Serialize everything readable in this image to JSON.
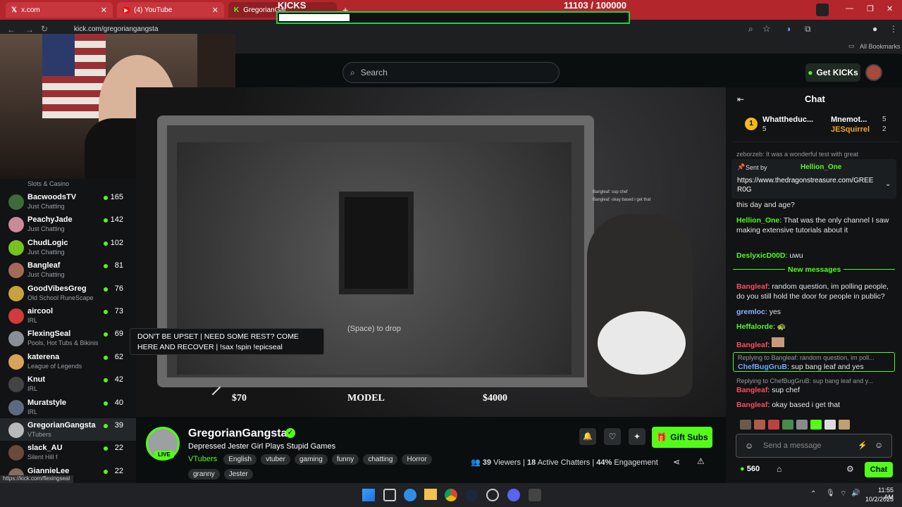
{
  "browser": {
    "tabs": [
      {
        "label": "x.com"
      },
      {
        "label": "(4) YouTube"
      },
      {
        "label": "GregorianGangsta"
      }
    ],
    "url": "kick.com/gregoriangangsta",
    "bookmarks_label": "All Bookmarks",
    "status_url": "https://kick.com/flexingseal"
  },
  "overlay": {
    "kicks_label": "KICKS",
    "kicks_count": "11103  / 100000",
    "kicks_progress": 0.111
  },
  "header": {
    "search_placeholder": "Search",
    "get_kicks_label": "Get KICKs"
  },
  "sidebar": {
    "top_category": "Slots & Casino",
    "channels": [
      {
        "name": "BacwoodsTV",
        "category": "Just Chatting",
        "viewers": "165",
        "color": "#3e6b3a"
      },
      {
        "name": "PeachyJade",
        "category": "Just Chatting",
        "viewers": "142",
        "color": "#c98a9c"
      },
      {
        "name": "ChudLogic",
        "category": "Just Chatting",
        "viewers": "102",
        "color": "#76c21f"
      },
      {
        "name": "Bangleaf",
        "category": "Just Chatting",
        "viewers": "81",
        "color": "#a46a58"
      },
      {
        "name": "GoodVibesGreg",
        "category": "Old School RuneScape",
        "viewers": "76",
        "color": "#c8a23c"
      },
      {
        "name": "aircool",
        "category": "IRL",
        "viewers": "73",
        "color": "#d23b3b"
      },
      {
        "name": "FlexingSeal",
        "category": "Pools, Hot Tubs & Bikinis",
        "viewers": "69",
        "color": "#8a8f96"
      },
      {
        "name": "katerena",
        "category": "League of Legends",
        "viewers": "62",
        "color": "#d9a35a"
      },
      {
        "name": "Knut",
        "category": "IRL",
        "viewers": "42",
        "color": "#444"
      },
      {
        "name": "Muratstyle",
        "category": "IRL",
        "viewers": "40",
        "color": "#5b6a80"
      },
      {
        "name": "GregorianGangsta",
        "category": "VTubers",
        "viewers": "39",
        "color": "#b9b9b9"
      },
      {
        "name": "slack_AU",
        "category": "Silent Hill f",
        "viewers": "22",
        "color": "#6b4a3a"
      },
      {
        "name": "GiannieLee",
        "category": "",
        "viewers": "22",
        "color": "#8a6a5a"
      }
    ]
  },
  "game": {
    "tooltip": "DON'T BE UPSET | NEED SOME REST? COME HERE AND RECOVER | !sax !spin !epicseal",
    "drop_hint": "(Space) to drop",
    "price_left": "$70",
    "model_label": "MODEL",
    "price_right": "$4000",
    "mini_chat": [
      {
        "user": "Bangleaf",
        "text": "sup chef"
      },
      {
        "user": "Bangleaf",
        "text": "okay based i get that"
      }
    ]
  },
  "stream": {
    "channel_name": "GregorianGangsta",
    "live_label": "LIVE",
    "title": "Depressed Jester Girl Plays Stupid Games",
    "category": "VTubers",
    "tags": [
      "English",
      "vtuber",
      "gaming",
      "funny",
      "chatting",
      "Horror",
      "granny",
      "Jester"
    ],
    "viewers": "39",
    "viewers_label": "Viewers",
    "chatters": "18",
    "chatters_label": "Active Chatters",
    "engagement": "44%",
    "engagement_label": "Engagement",
    "gift_subs_label": "Gift Subs"
  },
  "chat": {
    "title": "Chat",
    "leaderboard": [
      {
        "rank": "1",
        "name": "Whattheduc...",
        "count": "5"
      },
      {
        "name": "Mnemot...",
        "count": "5"
      },
      {
        "name": "JESquirrel",
        "count": "2"
      }
    ],
    "pinned_cut": "zeborzeb: It was a wonderful test with great",
    "pinned_sent_by": "Sent by",
    "pinned_user": "Hellion_One",
    "pinned_link": "https://www.thedragonstreasure.com/GREER0G",
    "messages_top": [
      {
        "user": "",
        "text": "this day and age?"
      },
      {
        "user": "Hellion_One",
        "text": "That was the only channel I saw making extensive tutorials about it"
      },
      {
        "user": "DeslyxicD00D",
        "text": "uwu"
      }
    ],
    "new_messages_label": "New messages",
    "messages": [
      {
        "user": "Bangleaf",
        "text": "random question, im polling people, do you still hold the door for people in public?"
      },
      {
        "user": "gremloc",
        "text": "yes"
      },
      {
        "user": "Heffalorde",
        "text": ""
      },
      {
        "user": "Bangleaf",
        "text": ""
      },
      {
        "reply": "Replying to Bangleaf: random question, im poll...",
        "user": "ChefBugGruB",
        "text": "sup bang leaf and yes"
      },
      {
        "reply": "Replying to ChefBugGruB: sup bang leaf and y...",
        "user": "Bangleaf",
        "text": "sup chef"
      },
      {
        "user": "Bangleaf",
        "text": "okay based i get that"
      }
    ],
    "input_placeholder": "Send a message",
    "points": "560",
    "send_label": "Chat"
  },
  "taskbar": {
    "time": "11:55 AM",
    "date": "10/2/2025"
  },
  "colors": {
    "kick_green": "#53fc18",
    "tab_red": "#b3262c",
    "username_red": "#ff4d5a",
    "username_green": "#53fc18"
  }
}
